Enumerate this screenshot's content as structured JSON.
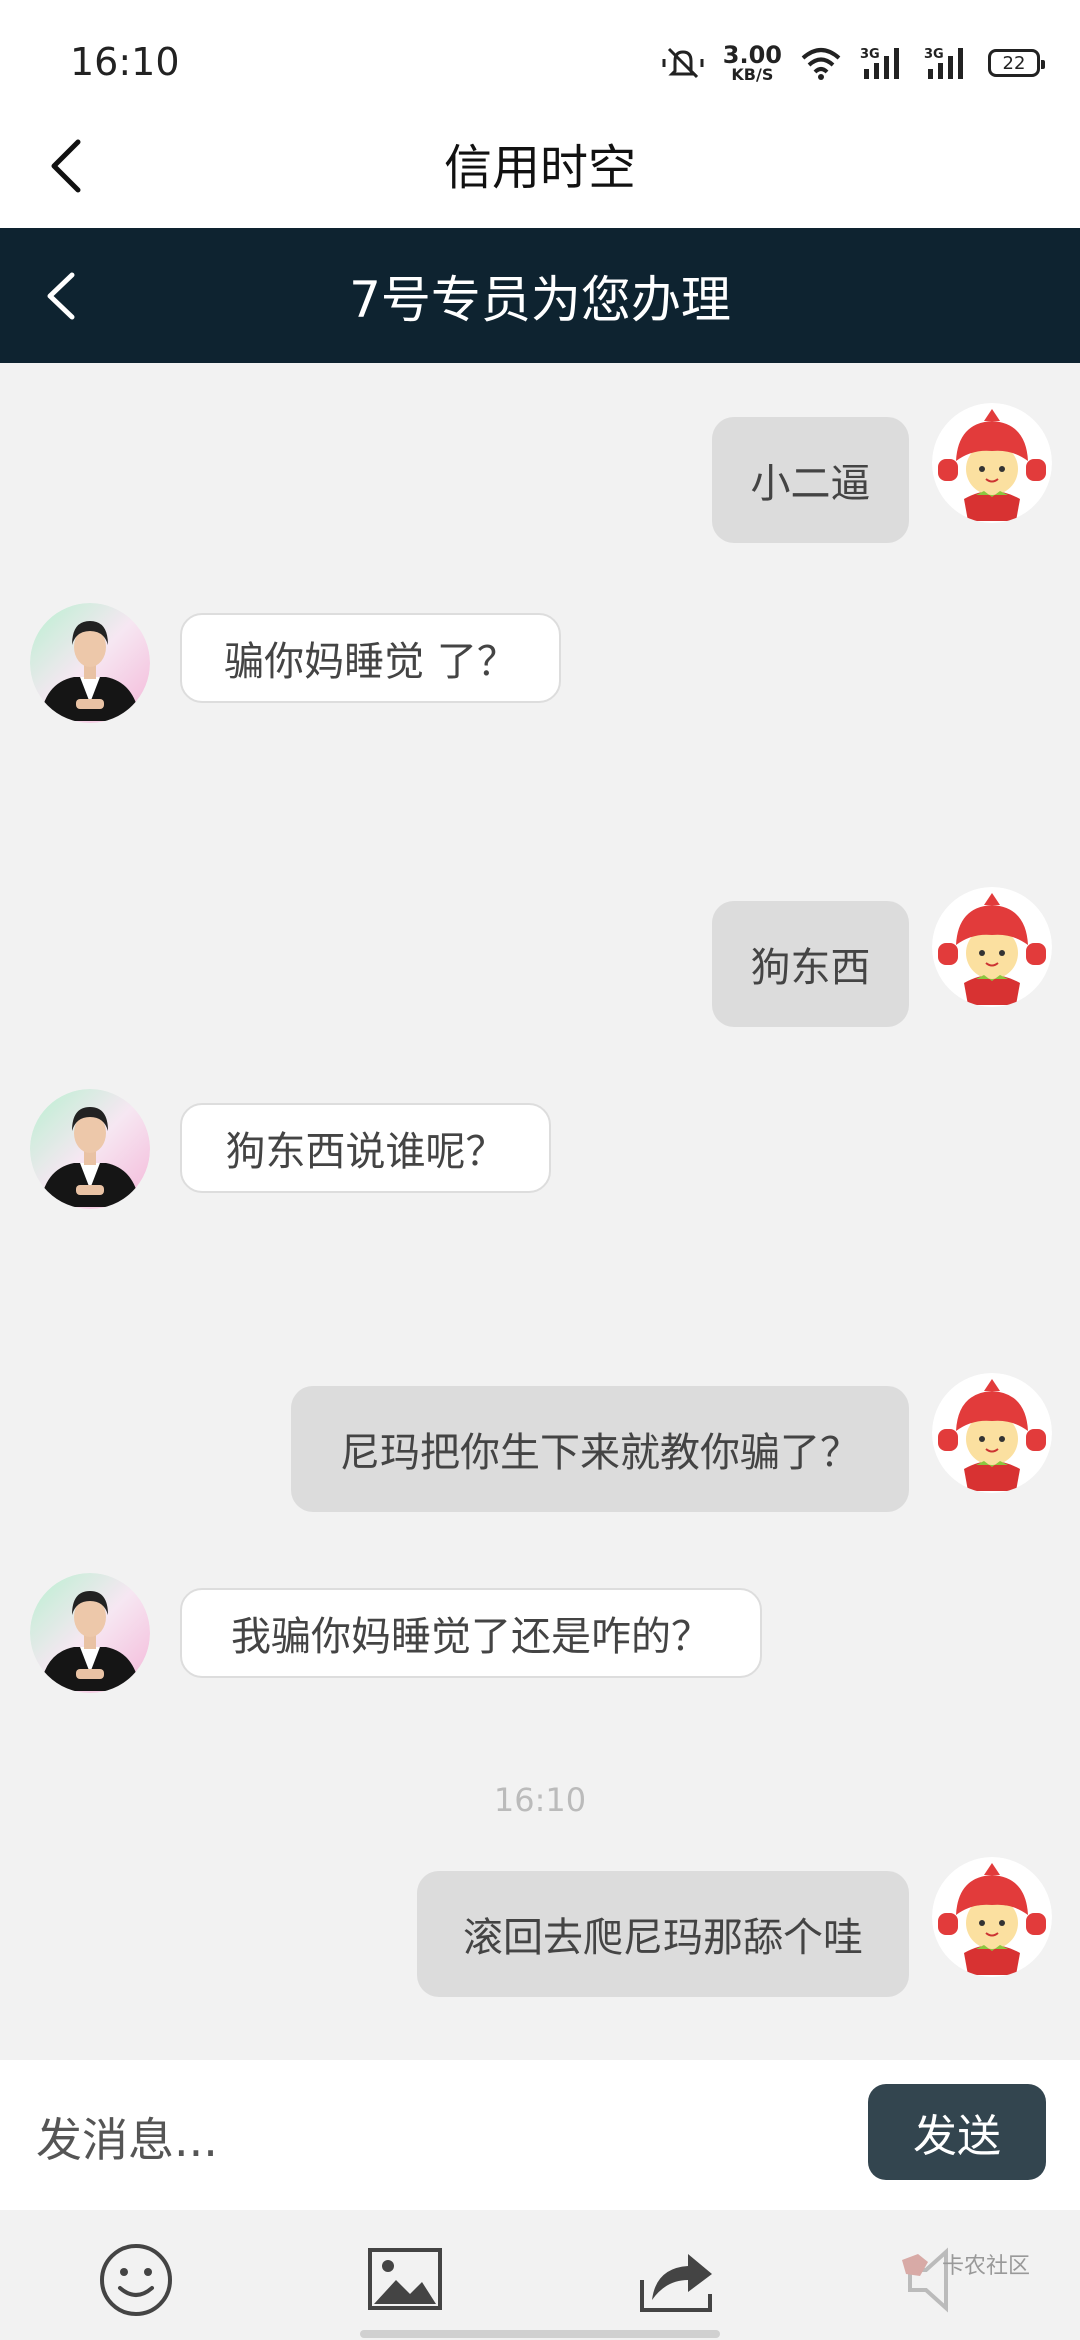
{
  "status_bar": {
    "time": "16:10",
    "net_speed_value": "3.00",
    "net_speed_unit": "KB/S",
    "signal_1_label": "3G",
    "signal_2_label": "3G",
    "battery": "22"
  },
  "header": {
    "title": "信用时空",
    "agent_title": "7号专员为您办理"
  },
  "messages": [
    {
      "side": "out",
      "text": "小二逼"
    },
    {
      "side": "in",
      "text": "骗你妈睡觉 了？"
    },
    {
      "side": "out",
      "text": "狗东西"
    },
    {
      "side": "in",
      "text": "狗东西说谁呢？"
    },
    {
      "side": "out",
      "text": "尼玛把你生下来就教你骗了？"
    },
    {
      "side": "in",
      "text": "我骗你妈睡觉了还是咋的？"
    },
    {
      "side": "out",
      "text": "滚回去爬尼玛那舔个哇"
    }
  ],
  "timestamp": "16:10",
  "input": {
    "placeholder": "发消息...",
    "value": ""
  },
  "send_label": "发送",
  "toolbar": {
    "icons": [
      "emoji-icon",
      "image-icon",
      "share-icon",
      "volume-icon"
    ]
  },
  "watermark": "卡农社区",
  "colors": {
    "agent_bar": "#0e2330",
    "send_button": "#33454f",
    "out_bubble": "#dcdcdc",
    "in_bubble": "#ffffff",
    "chat_background": "#f2f2f2"
  }
}
